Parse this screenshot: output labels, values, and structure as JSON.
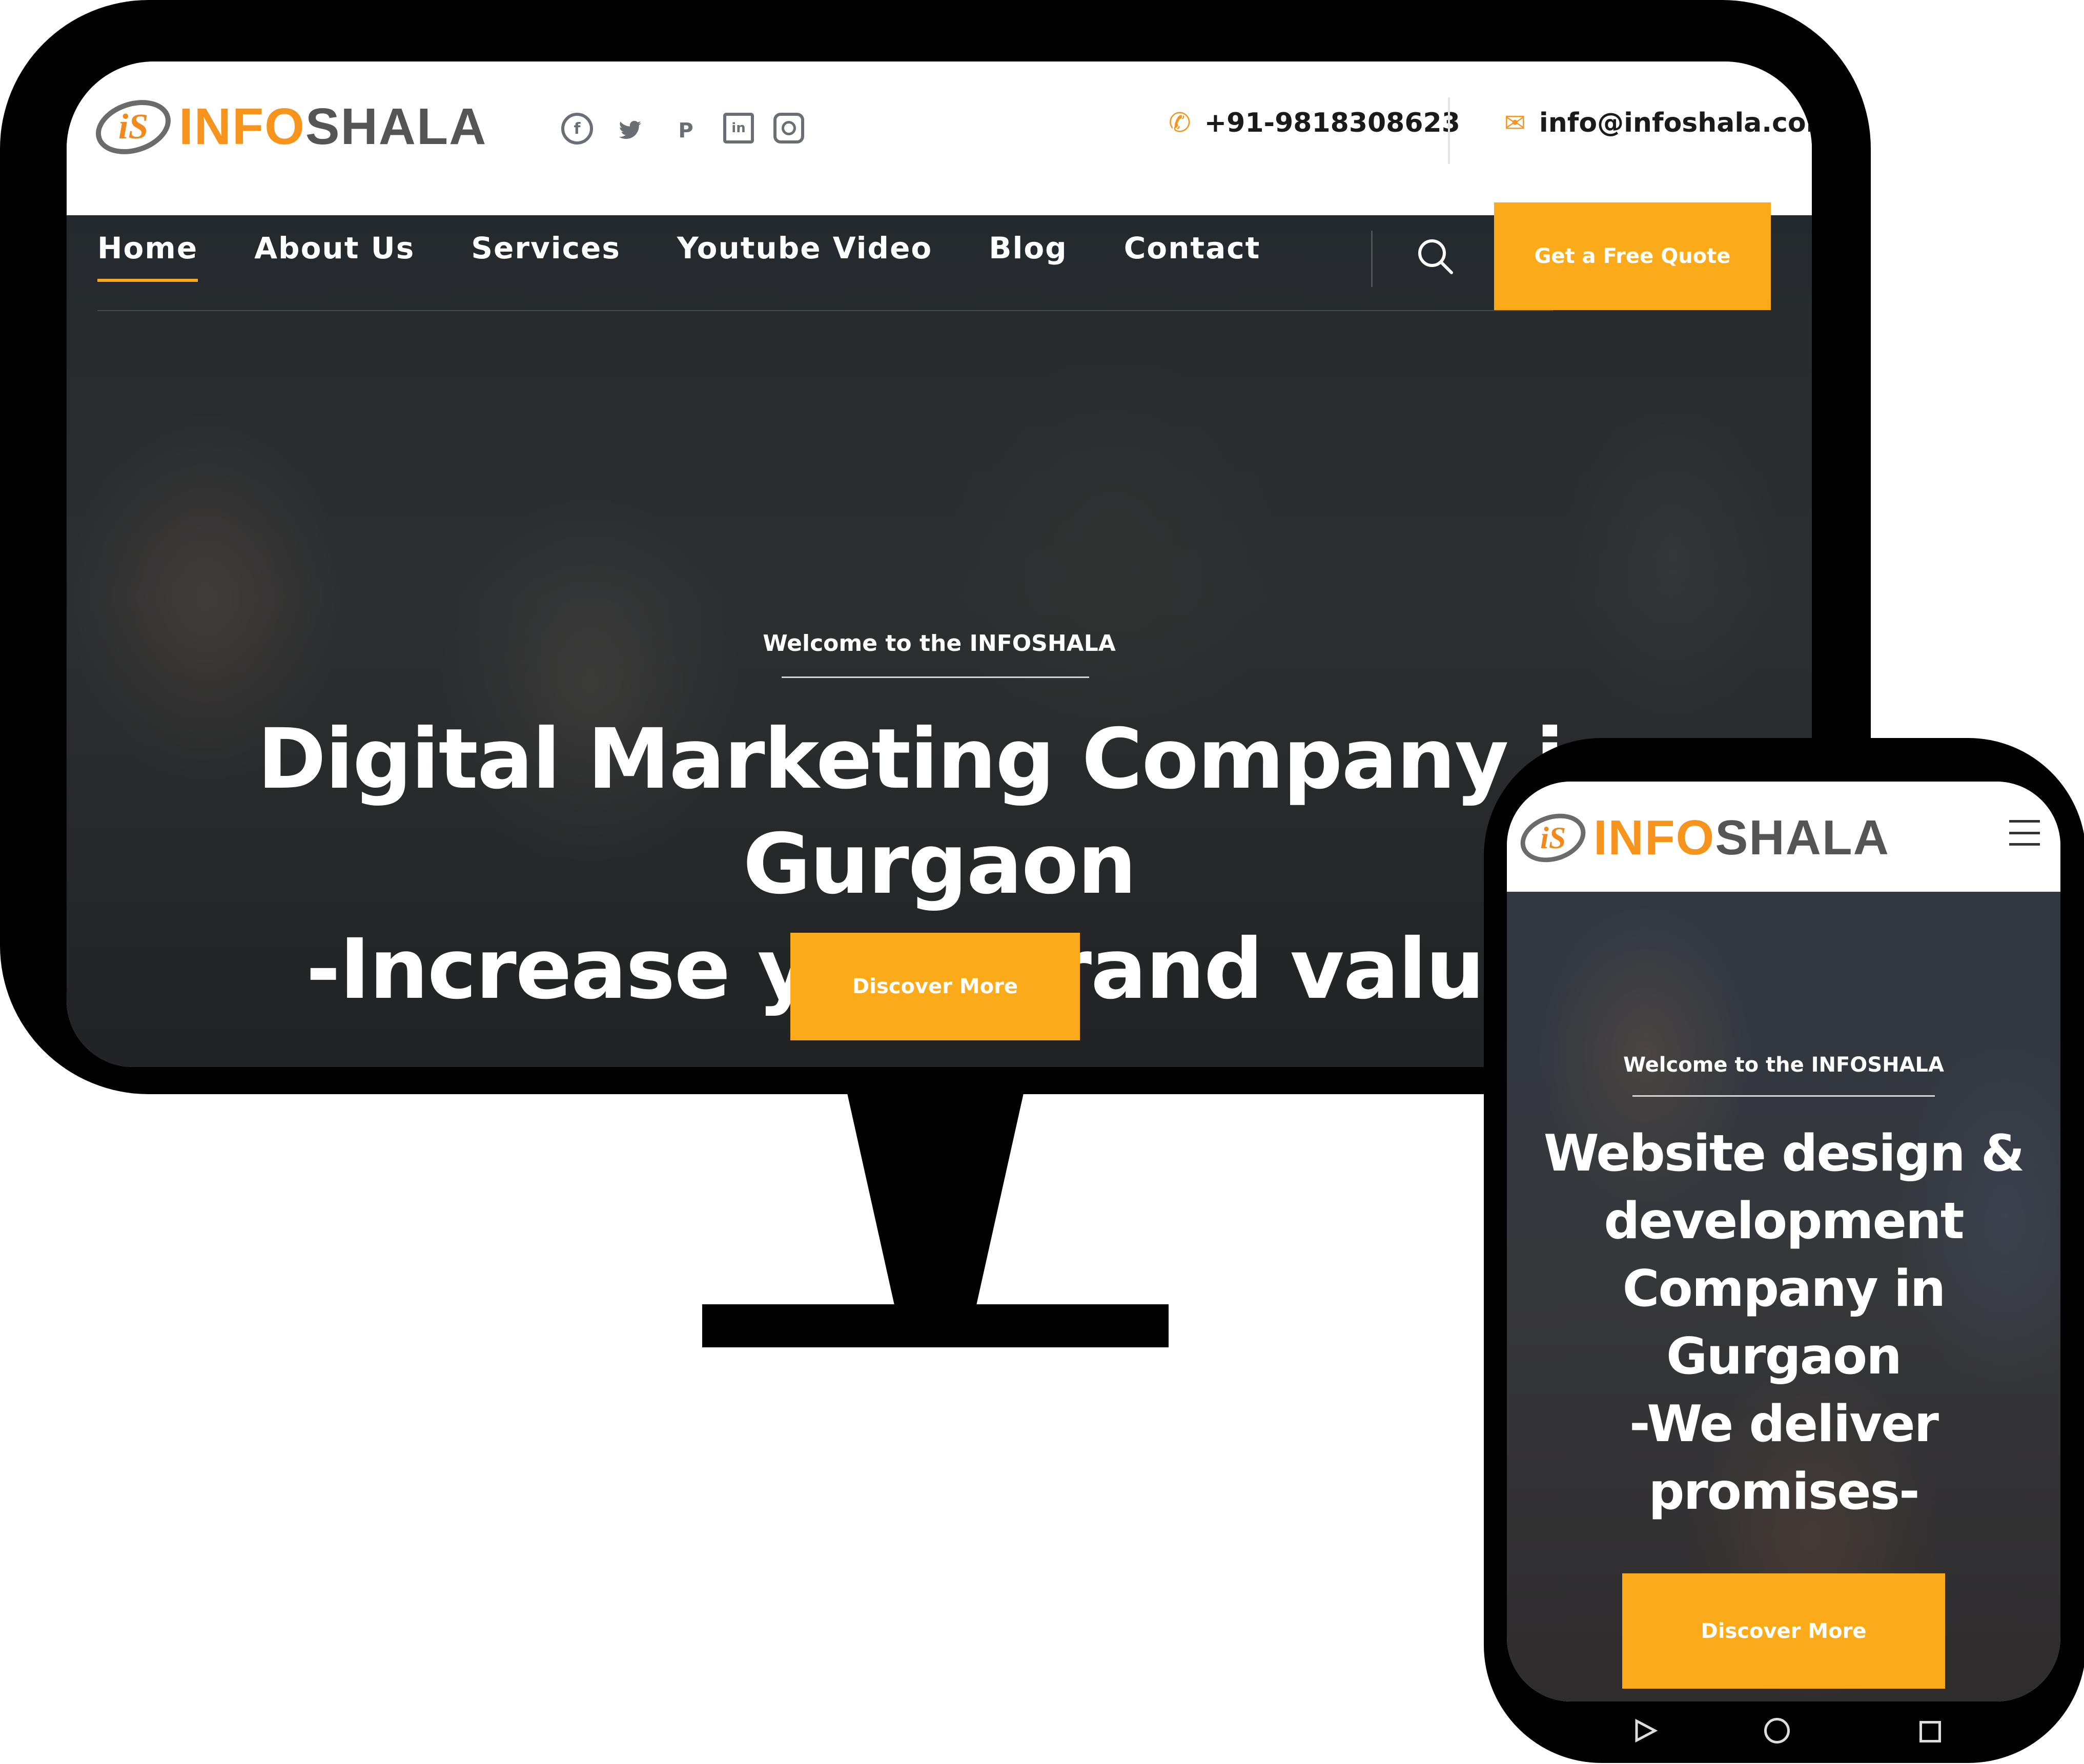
{
  "colors": {
    "accent": "#fbab1a",
    "logo_orange": "#f7941d",
    "logo_gray": "#555555",
    "bezel": "#000000"
  },
  "desktop": {
    "logo": {
      "mark": "iS",
      "info": "INFO",
      "shala": "SHALA"
    },
    "social_icons": [
      "facebook-icon",
      "twitter-icon",
      "pinterest-icon",
      "linkedin-icon",
      "instagram-icon"
    ],
    "social_glyphs": {
      "facebook": "f",
      "twitter": "🐦",
      "pinterest": "P",
      "linkedin": "in"
    },
    "phone": "+91-9818308623",
    "email": "info@infoshala.com",
    "nav": [
      "Home",
      "About Us",
      "Services",
      "Youtube Video",
      "Blog",
      "Contact"
    ],
    "active_nav": "Home",
    "quote_button": "Get a Free Quote",
    "welcome": "Welcome to the INFOSHALA",
    "headline_line1": "Digital Marketing Company in Gurgaon",
    "headline_line2": "-Increase your brand value-",
    "cta": "Discover More"
  },
  "mobile": {
    "logo": {
      "mark": "iS",
      "info": "INFO",
      "shala": "SHALA"
    },
    "welcome": "Welcome to the INFOSHALA",
    "headline_lines": [
      "Website design &",
      "development",
      "Company in",
      "Gurgaon",
      "-We deliver",
      "promises-"
    ],
    "cta": "Discover More",
    "nav_buttons": [
      "back-icon",
      "home-icon",
      "recent-apps-icon"
    ]
  }
}
